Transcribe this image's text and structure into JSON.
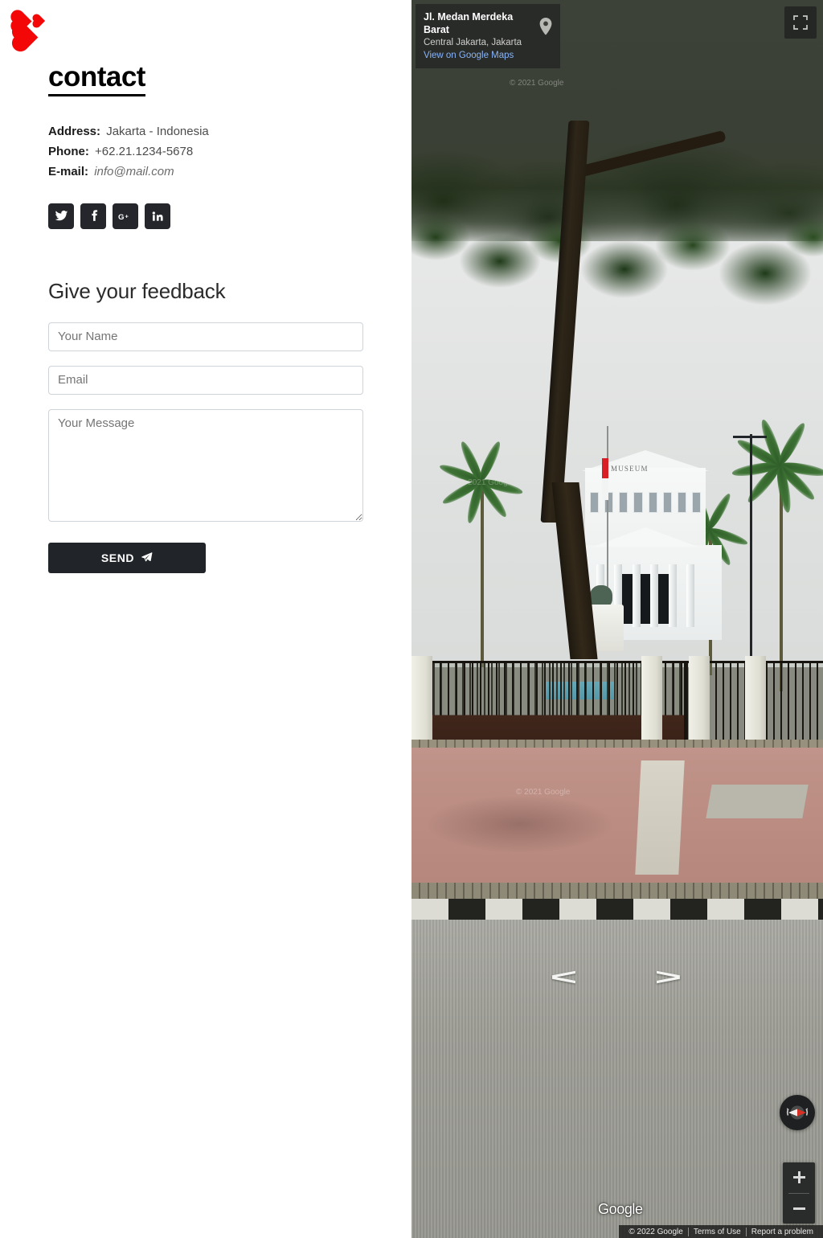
{
  "brand": {
    "logo_icon": "three-hearts-logo",
    "logo_color": "#f40707"
  },
  "contact": {
    "title": "contact",
    "details": [
      {
        "label": "Address:",
        "value": "Jakarta - Indonesia",
        "style": "normal"
      },
      {
        "label": "Phone:",
        "value": "+62.21.1234-5678",
        "style": "normal"
      },
      {
        "label": "E-mail:",
        "value": "info@mail.com",
        "style": "italic"
      }
    ],
    "socials": [
      {
        "name": "twitter-icon",
        "label": "Twitter"
      },
      {
        "name": "facebook-icon",
        "label": "Facebook"
      },
      {
        "name": "google-plus-icon",
        "label": "Google Plus"
      },
      {
        "name": "linkedin-icon",
        "label": "LinkedIn"
      }
    ],
    "social_bg": "#24262b"
  },
  "feedback": {
    "heading": "Give your feedback",
    "name_placeholder": "Your Name",
    "name_value": "",
    "email_placeholder": "Email",
    "email_value": "",
    "message_placeholder": "Your Message",
    "message_value": "",
    "send_label": "SEND",
    "send_icon": "paper-plane-icon",
    "send_bg": "#212529"
  },
  "map": {
    "address_card": {
      "title": "Jl. Medan Merdeka Barat",
      "subtitle": "Central Jakarta, Jakarta",
      "link": "View on Google Maps",
      "pin_icon": "map-pin-icon",
      "link_color": "#8ab4f8"
    },
    "fullscreen_icon": "fullscreen-icon",
    "compass_icon": "compass-icon",
    "zoom_in_label": "+",
    "zoom_out_label": "−",
    "nav_left_icon": "street-nav-left-chevron",
    "nav_right_icon": "street-nav-right-chevron",
    "google_logo": "Google",
    "imagery_watermark": "© 2021 Google",
    "attribution": [
      "© 2022 Google",
      "Terms of Use",
      "Report a problem"
    ],
    "scene": {
      "building_label": "MUSEUM",
      "flag": "Indonesia"
    }
  }
}
